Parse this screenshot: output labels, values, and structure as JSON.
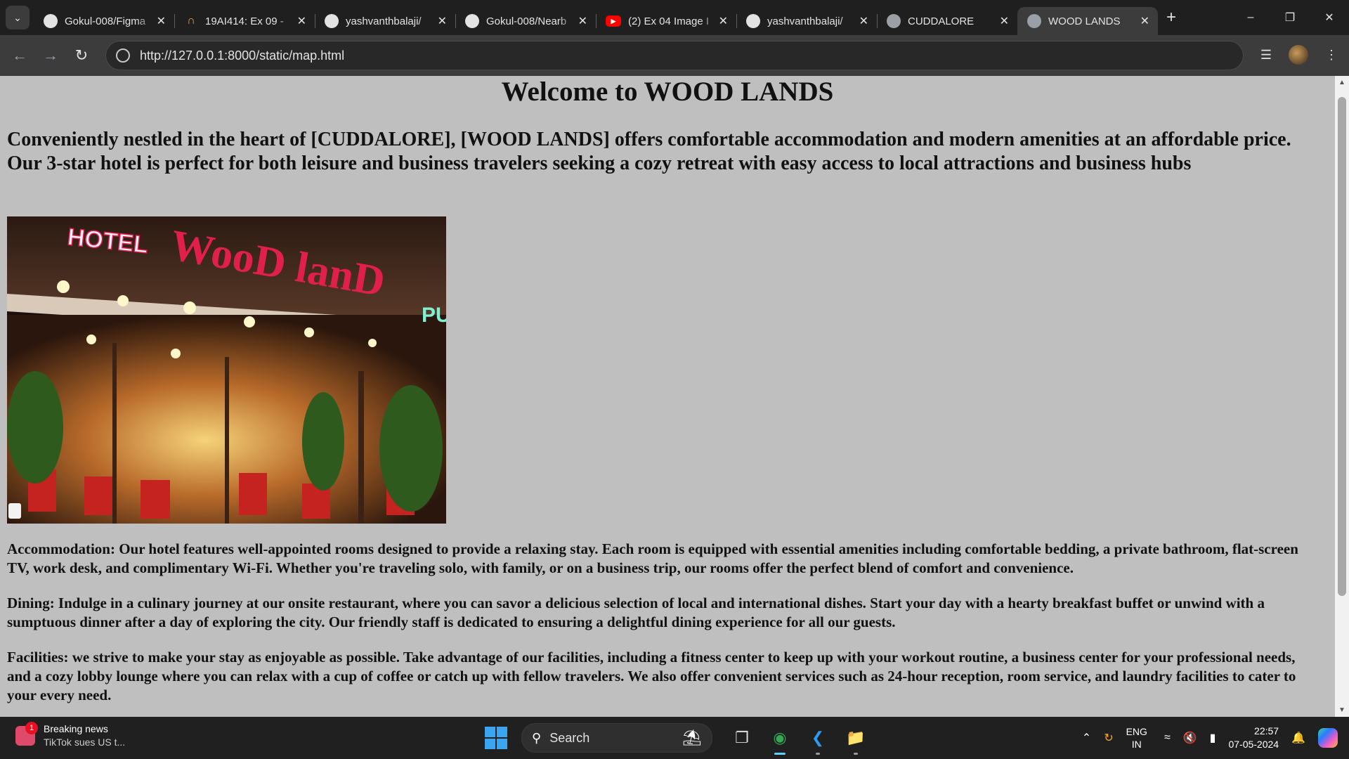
{
  "browser": {
    "tabs": [
      {
        "title": "Gokul-008/Figma",
        "icon": "github-icon"
      },
      {
        "title": "19AI414: Ex 09 -",
        "icon": "hackerrank-icon"
      },
      {
        "title": "yashvanthbalaji/",
        "icon": "github-icon"
      },
      {
        "title": "Gokul-008/Nearb",
        "icon": "github-icon"
      },
      {
        "title": "(2) Ex 04 Image I",
        "icon": "youtube-icon"
      },
      {
        "title": "yashvanthbalaji/",
        "icon": "github-icon"
      },
      {
        "title": "CUDDALORE",
        "icon": "globe-icon"
      },
      {
        "title": "WOOD LANDS",
        "icon": "globe-icon",
        "active": true
      }
    ],
    "url": "http://127.0.0.1:8000/static/map.html"
  },
  "page": {
    "title": "Welcome to WOOD LANDS",
    "intro": "Conveniently nestled in the heart of [CUDDALORE], [WOOD LANDS] offers comfortable accommodation and modern amenities at an affordable price. Our 3-star hotel is perfect for both leisure and business travelers seeking a cozy retreat with easy access to local attractions and business hubs",
    "photo": {
      "sign_text": "HOTEL WooD lanD",
      "side_text": "PUB"
    },
    "paragraphs": [
      "Accommodation: Our hotel features well-appointed rooms designed to provide a relaxing stay. Each room is equipped with essential amenities including comfortable bedding, a private bathroom, flat-screen TV, work desk, and complimentary Wi-Fi. Whether you're traveling solo, with family, or on a business trip, our rooms offer the perfect blend of comfort and convenience.",
      "Dining: Indulge in a culinary journey at our onsite restaurant, where you can savor a delicious selection of local and international dishes. Start your day with a hearty breakfast buffet or unwind with a sumptuous dinner after a day of exploring the city. Our friendly staff is dedicated to ensuring a delightful dining experience for all our guests.",
      "Facilities: we strive to make your stay as enjoyable as possible. Take advantage of our facilities, including a fitness center to keep up with your workout routine, a business center for your professional needs, and a cozy lobby lounge where you can relax with a cup of coffee or catch up with fellow travelers. We also offer convenient services such as 24-hour reception, room service, and laundry facilities to cater to your every need."
    ]
  },
  "taskbar": {
    "news_title": "Breaking news",
    "news_sub": "TikTok sues US t...",
    "news_badge": "1",
    "search_label": "Search",
    "lang_top": "ENG",
    "lang_bottom": "IN",
    "time": "22:57",
    "date": "07-05-2024"
  },
  "colors": {
    "page_bg": "#bfbfbf",
    "chrome_dark": "#1f1f1f",
    "toolbar": "#3c3c3c"
  }
}
